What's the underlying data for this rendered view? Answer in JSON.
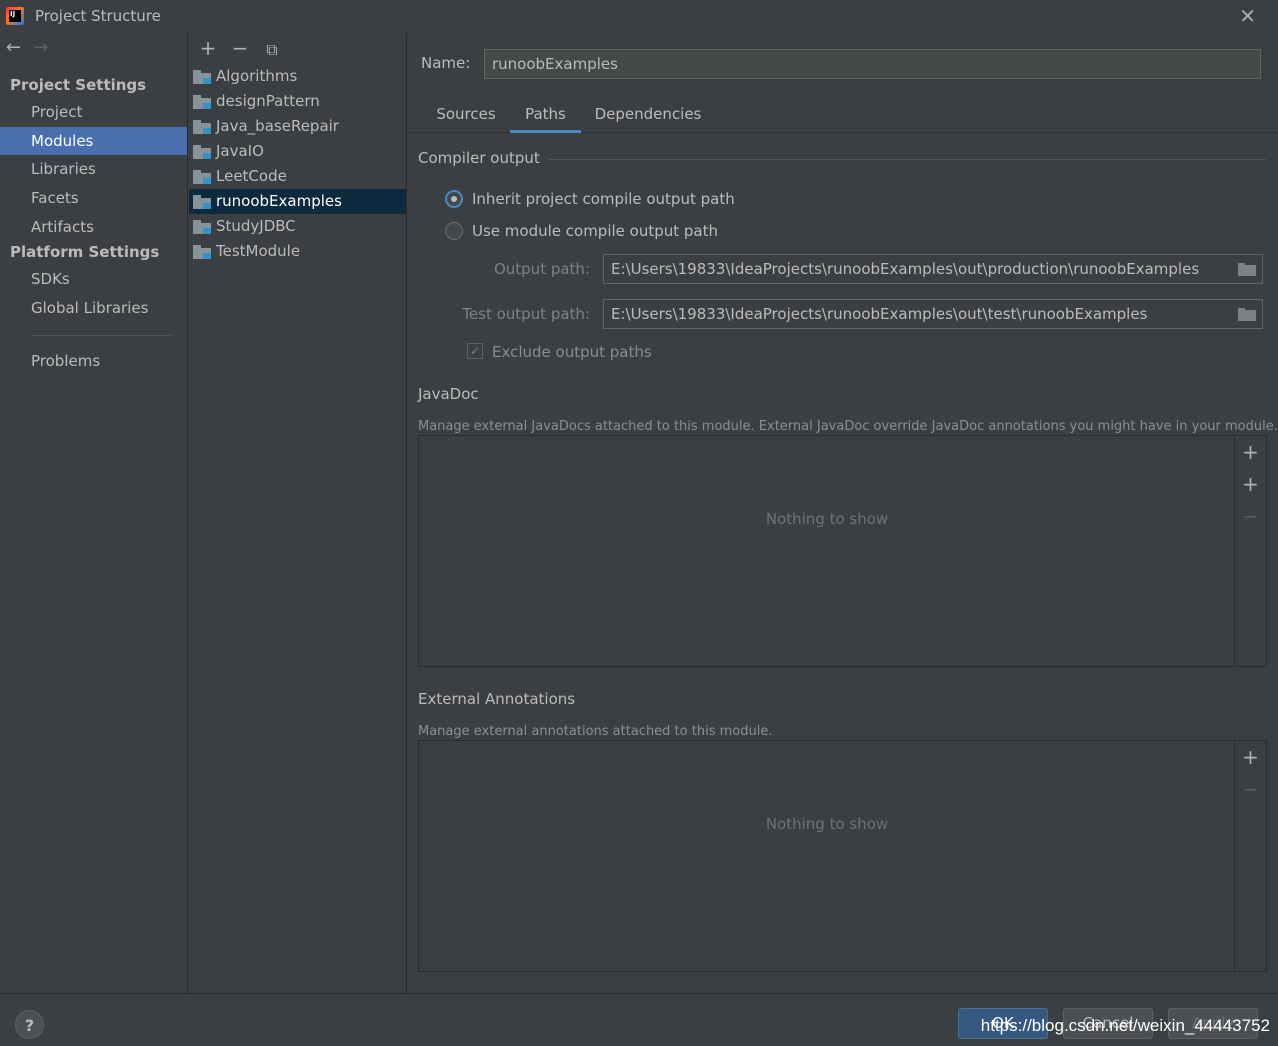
{
  "window": {
    "title": "Project Structure",
    "close_glyph": "✕"
  },
  "nav": {
    "back_glyph": "←",
    "forward_glyph": "→",
    "project_settings": "Project Settings",
    "platform_settings": "Platform Settings",
    "items": {
      "project": "Project",
      "modules": "Modules",
      "libraries": "Libraries",
      "facets": "Facets",
      "artifacts": "Artifacts",
      "sdks": "SDKs",
      "global_libraries": "Global Libraries",
      "problems": "Problems"
    },
    "selected": "Modules"
  },
  "modules_panel": {
    "toolbar": {
      "add": "+",
      "remove": "−",
      "copy": "⧉"
    },
    "items": [
      "Algorithms",
      "designPattern",
      "Java_baseRepair",
      "JavaIO",
      "LeetCode",
      "runoobExamples",
      "StudyJDBC",
      "TestModule"
    ],
    "selected": "runoobExamples"
  },
  "main": {
    "name_label": "Name:",
    "name_value": "runoobExamples",
    "tabs": [
      "Sources",
      "Paths",
      "Dependencies"
    ],
    "active_tab": "Paths",
    "compiler_output": {
      "title": "Compiler output",
      "inherit_label": "Inherit project compile output path",
      "use_module_label": "Use module compile output path",
      "selected_option": "Inherit project compile output path",
      "output_path_label": "Output path:",
      "output_path_value": "E:\\Users\\19833\\IdeaProjects\\runoobExamples\\out\\production\\runoobExamples",
      "test_output_path_label": "Test output path:",
      "test_output_path_value": "E:\\Users\\19833\\IdeaProjects\\runoobExamples\\out\\test\\runoobExamples",
      "exclude_label": "Exclude output paths",
      "exclude_checked": true
    },
    "javadoc": {
      "title": "JavaDoc",
      "description": "Manage external JavaDocs attached to this module. External JavaDoc override JavaDoc annotations you might have in your module.",
      "empty": "Nothing to show",
      "add_glyph": "+",
      "add_url_glyph": "+",
      "remove_glyph": "−"
    },
    "annotations": {
      "title": "External Annotations",
      "description": "Manage external annotations attached to this module.",
      "empty": "Nothing to show",
      "add_glyph": "+",
      "remove_glyph": "−"
    }
  },
  "footer": {
    "help": "?",
    "ok": "OK",
    "cancel": "Cancel",
    "apply": "Apply",
    "watermark": "https://blog.csdn.net/weixin_44443752"
  },
  "colors": {
    "background": "#3c3f41",
    "nav_selected": "#4b6eaf",
    "list_selected": "#0d293e",
    "tab_underline": "#4a88c7",
    "primary_button": "#365880"
  }
}
